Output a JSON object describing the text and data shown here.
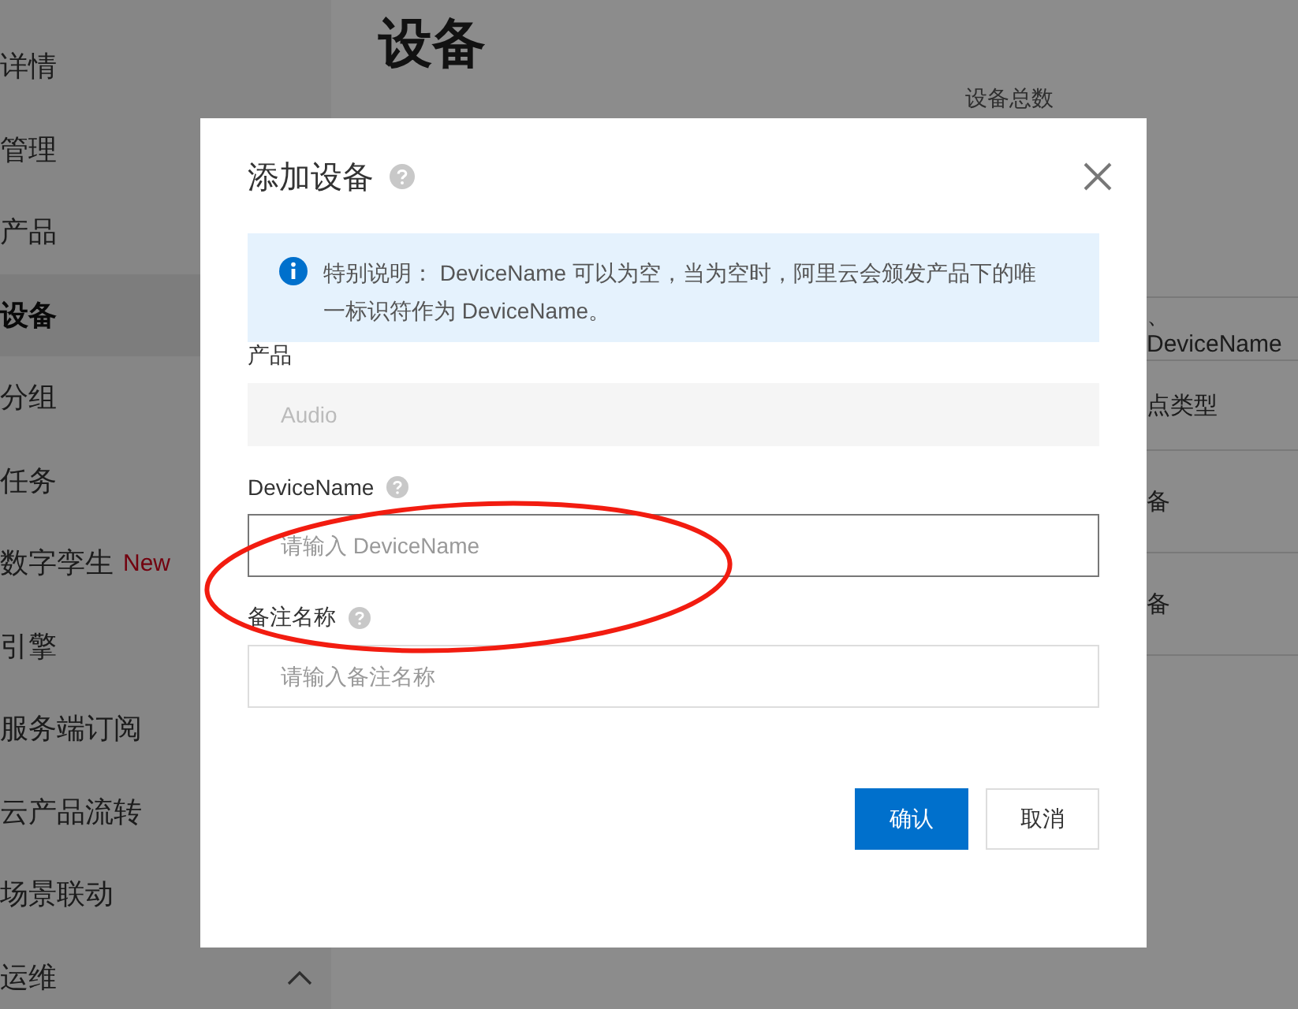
{
  "sidebar": {
    "items": [
      {
        "label": "详情",
        "selected": false,
        "kind": "link"
      },
      {
        "label": "管理",
        "selected": false,
        "kind": "link"
      },
      {
        "label": "产品",
        "selected": false,
        "kind": "link"
      },
      {
        "label": "设备",
        "selected": true,
        "kind": "link"
      },
      {
        "label": "分组",
        "selected": false,
        "kind": "link"
      },
      {
        "label": "任务",
        "selected": false,
        "kind": "link"
      },
      {
        "label": "数字孪生",
        "selected": false,
        "kind": "link",
        "badge": "New"
      },
      {
        "label": "引擎",
        "selected": false,
        "kind": "link"
      },
      {
        "label": "服务端订阅",
        "selected": false,
        "kind": "link"
      },
      {
        "label": "云产品流转",
        "selected": false,
        "kind": "link"
      },
      {
        "label": "场景联动",
        "selected": false,
        "kind": "link"
      },
      {
        "label": "运维",
        "selected": false,
        "kind": "group",
        "expanded": true
      }
    ]
  },
  "main": {
    "title": "设备",
    "stat_label": "设备总数",
    "table_fragments": [
      "、DeviceName",
      "点类型",
      "备",
      "备"
    ]
  },
  "dialog": {
    "title": "添加设备",
    "notice": "特别说明： DeviceName 可以为空，当为空时，阿里云会颁发产品下的唯一标识符作为 DeviceName。",
    "fields": [
      {
        "label": "产品",
        "value": "Audio",
        "disabled": true,
        "help": false,
        "focused": false
      },
      {
        "label": "DeviceName",
        "placeholder": "请输入 DeviceName",
        "disabled": false,
        "help": true,
        "focused": true
      },
      {
        "label": "备注名称",
        "placeholder": "请输入备注名称",
        "disabled": false,
        "help": true,
        "focused": false
      }
    ],
    "buttons": [
      {
        "label": "确认",
        "kind": "primary"
      },
      {
        "label": "取消",
        "kind": "secondary"
      }
    ]
  },
  "annotation": {
    "kind": "ellipse"
  }
}
